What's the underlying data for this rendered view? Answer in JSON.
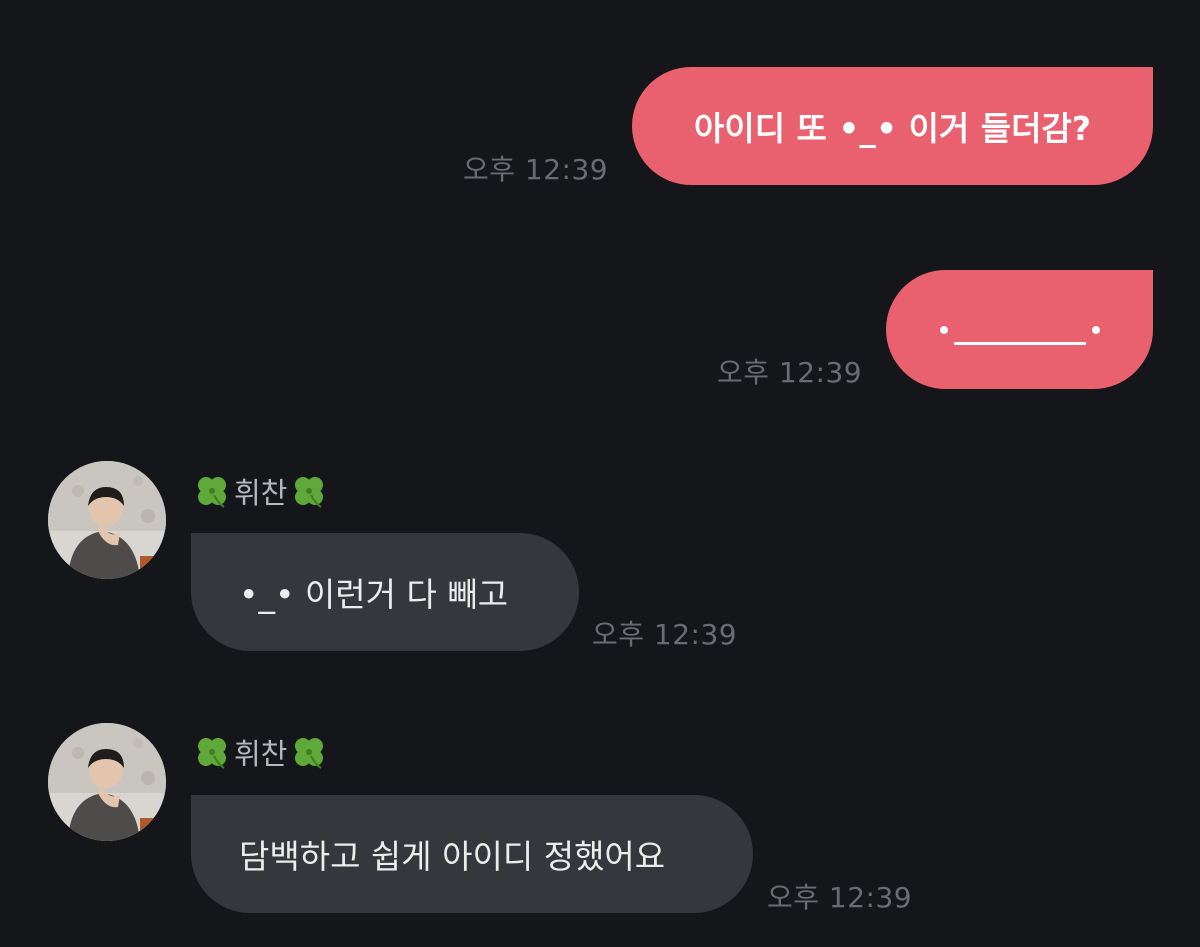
{
  "messages": [
    {
      "direction": "outgoing",
      "text": "아이디 또 •_• 이거 들더감?",
      "time": "오후 12:39"
    },
    {
      "direction": "outgoing",
      "text": "•______•",
      "time": "오후 12:39"
    },
    {
      "direction": "incoming",
      "sender": "휘찬",
      "text": "•_• 이런거 다 빼고",
      "time": "오후 12:39"
    },
    {
      "direction": "incoming",
      "sender": "휘찬",
      "text": "담백하고 쉽게 아이디 정했어요",
      "time": "오후 12:39"
    }
  ],
  "icons": {
    "sender_decoration": "four-leaf-clover-icon",
    "avatar": "profile-photo"
  },
  "colors": {
    "background": "#151619",
    "outgoing_bubble": "#e9606f",
    "incoming_bubble": "#36373c",
    "timestamp": "#6b6c72",
    "sender_name": "#b7b8bd"
  }
}
